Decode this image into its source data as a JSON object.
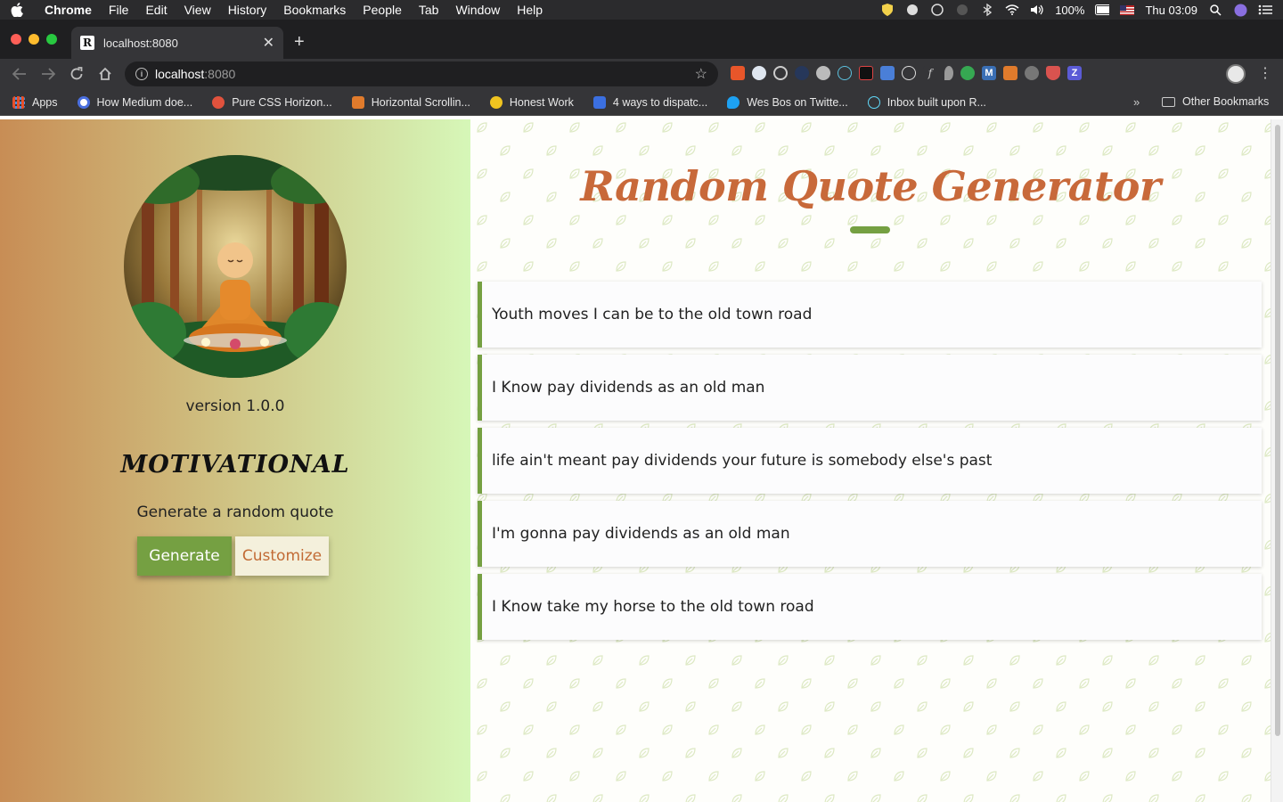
{
  "menubar": {
    "app_name": "Chrome",
    "items": [
      "File",
      "Edit",
      "View",
      "History",
      "Bookmarks",
      "People",
      "Tab",
      "Window",
      "Help"
    ],
    "battery": "100%",
    "clock": "Thu 03:09"
  },
  "tab": {
    "title": "localhost:8080",
    "favicon_letter": "R"
  },
  "omnibox": {
    "host": "localhost",
    "port": ":8080"
  },
  "bookmarks": {
    "items": [
      {
        "label": "Apps",
        "color": "#4a90e2"
      },
      {
        "label": "How Medium doe...",
        "color": "#ffffff"
      },
      {
        "label": "Pure CSS Horizon...",
        "color": "#e1523d"
      },
      {
        "label": "Horizontal Scrollin...",
        "color": "#e07b2c"
      },
      {
        "label": "Honest Work",
        "color": "#f0c420"
      },
      {
        "label": "4 ways to dispatc...",
        "color": "#3b6fe0"
      },
      {
        "label": "Wes Bos on Twitte...",
        "color": "#1da1f2"
      },
      {
        "label": "Inbox built upon R...",
        "color": "#61dafb"
      }
    ],
    "more": "»",
    "other": "Other Bookmarks"
  },
  "sidebar": {
    "version": "version 1.0.0",
    "category": "MOTIVATIONAL",
    "subtitle": "Generate a random quote",
    "generate_label": "Generate",
    "customize_label": "Customize"
  },
  "main": {
    "title": "Random Quote Generator",
    "quotes": [
      "Youth moves I can be to the old town road",
      "I Know pay dividends as an old man",
      "life ain't meant pay dividends your future is somebody else's past",
      "I'm gonna pay dividends as an old man",
      "I Know take my horse to the old town road"
    ]
  },
  "colors": {
    "accent_green": "#75a042",
    "title_orange": "#c8693a",
    "customize_bg": "#f4f0dc"
  }
}
